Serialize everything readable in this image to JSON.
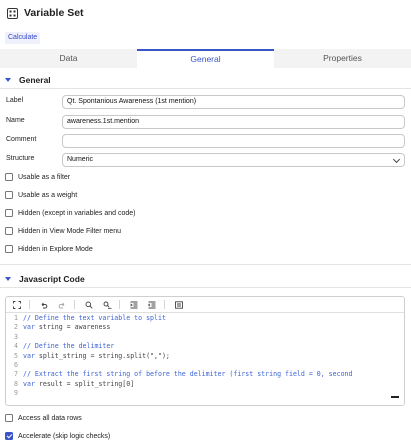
{
  "header": {
    "title": "Variable Set",
    "title_icon": "grid-icon"
  },
  "calculate_label": "Calculate",
  "tabs": [
    {
      "label": "Data",
      "active": false
    },
    {
      "label": "General",
      "active": true
    },
    {
      "label": "Properties",
      "active": false
    }
  ],
  "general": {
    "heading": "General",
    "label_label": "Label",
    "label_value": "Qt. Spontanious Awareness (1st mention)",
    "name_label": "Name",
    "name_value": "awareness.1st.mention",
    "comment_label": "Comment",
    "comment_value": "",
    "structure_label": "Structure",
    "structure_value": "Numeric"
  },
  "options": [
    {
      "label": "Usable as a filter",
      "checked": false
    },
    {
      "label": "Usable as a weight",
      "checked": false
    },
    {
      "label": "Hidden (except in variables and code)",
      "checked": false
    },
    {
      "label": "Hidden in View Mode Filter menu",
      "checked": false
    },
    {
      "label": "Hidden in Explore Mode",
      "checked": false
    }
  ],
  "javascript": {
    "heading": "Javascript Code",
    "toolbar": [
      "fullscreen-icon",
      "undo-icon",
      "redo-icon",
      "search-icon",
      "replace-icon",
      "indent-icon",
      "outdent-icon",
      "comment-icon"
    ],
    "lines": [
      {
        "n": "1",
        "segments": [
          {
            "t": "// Define the text variable to split",
            "c": "comment"
          }
        ]
      },
      {
        "n": "2",
        "segments": [
          {
            "t": "var",
            "c": "kw"
          },
          {
            "t": " string = awareness",
            "c": ""
          }
        ]
      },
      {
        "n": "3",
        "segments": []
      },
      {
        "n": "4",
        "segments": [
          {
            "t": "// Define the delimiter",
            "c": "comment"
          }
        ]
      },
      {
        "n": "5",
        "segments": [
          {
            "t": "var",
            "c": "kw"
          },
          {
            "t": " split_string = string.split(\",\");",
            "c": ""
          }
        ]
      },
      {
        "n": "6",
        "segments": []
      },
      {
        "n": "7",
        "segments": [
          {
            "t": "// Extract the first string of before the delimiter (first string field = 0, second",
            "c": "comment"
          }
        ]
      },
      {
        "n": "8",
        "segments": [
          {
            "t": "var",
            "c": "kw"
          },
          {
            "t": " result = split_string[0]",
            "c": ""
          }
        ]
      },
      {
        "n": "9",
        "segments": []
      }
    ]
  },
  "bottom_options": [
    {
      "label": "Access all data rows",
      "checked": false
    },
    {
      "label": "Accelerate (skip logic checks)",
      "checked": true
    }
  ],
  "colors": {
    "accent": "#3a55c7",
    "comment": "#3c63d6"
  }
}
